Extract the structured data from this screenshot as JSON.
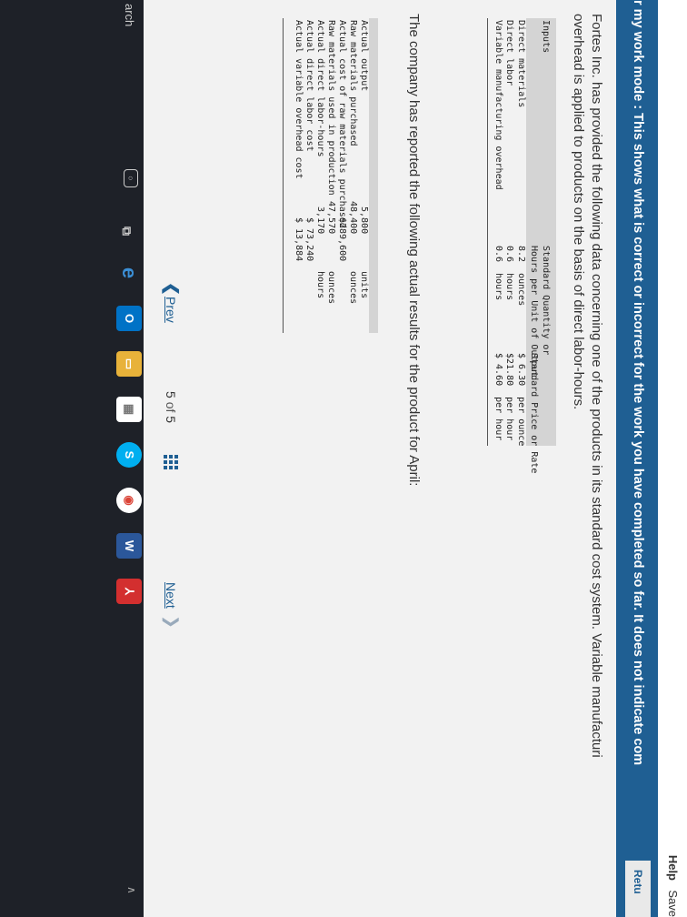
{
  "topbar": {
    "help": "Help",
    "save": "Save"
  },
  "banner": {
    "text": "r my work mode : This shows what is correct or incorrect for the work you have completed so far. It does not indicate com",
    "return_label": "Retu"
  },
  "intro": {
    "line1": "Fortes Inc. has provided the following data concerning one of the products in its standard cost system. Variable manufacturi",
    "line2": "overhead is applied to products on the basis of direct labor-hours."
  },
  "standards_table": {
    "header_col1": "Inputs",
    "header_col2_line1": "Standard Quantity or",
    "header_col2_line2": "Hours per Unit of Output",
    "header_col3": "Standard Price or Rate",
    "rows": [
      {
        "input": "Direct materials",
        "qty": "8.2  ounces",
        "price": "$ 6.30  per ounce"
      },
      {
        "input": "Direct labor",
        "qty": "0.6  hours",
        "price": "$21.80  per hour"
      },
      {
        "input": "Variable manufacturing overhead",
        "qty": "0.6  hours",
        "price": "$ 4.60  per hour"
      }
    ]
  },
  "mid_text": "The company has reported the following actual results for the product for April:",
  "actuals_table": {
    "rows": [
      {
        "label": "Actual output",
        "value": "5,800",
        "unit": "units"
      },
      {
        "label": "Raw materials purchased",
        "value": "48,400",
        "unit": "ounces"
      },
      {
        "label": "Actual cost of raw materials purchased",
        "value": "$289,600",
        "unit": ""
      },
      {
        "label": "Raw materials used in production",
        "value": "47,570",
        "unit": "ounces"
      },
      {
        "label": "Actual direct labor-hours",
        "value": "3,170",
        "unit": "hours"
      },
      {
        "label": "Actual direct labor cost",
        "value": "$ 73,240",
        "unit": ""
      },
      {
        "label": "Actual variable overhead cost",
        "value": "$ 13,884",
        "unit": ""
      }
    ]
  },
  "pager": {
    "prev": "Prev",
    "current": "5",
    "of": "of",
    "total": "5",
    "next": "Next"
  },
  "taskbar": {
    "search": "arch"
  }
}
